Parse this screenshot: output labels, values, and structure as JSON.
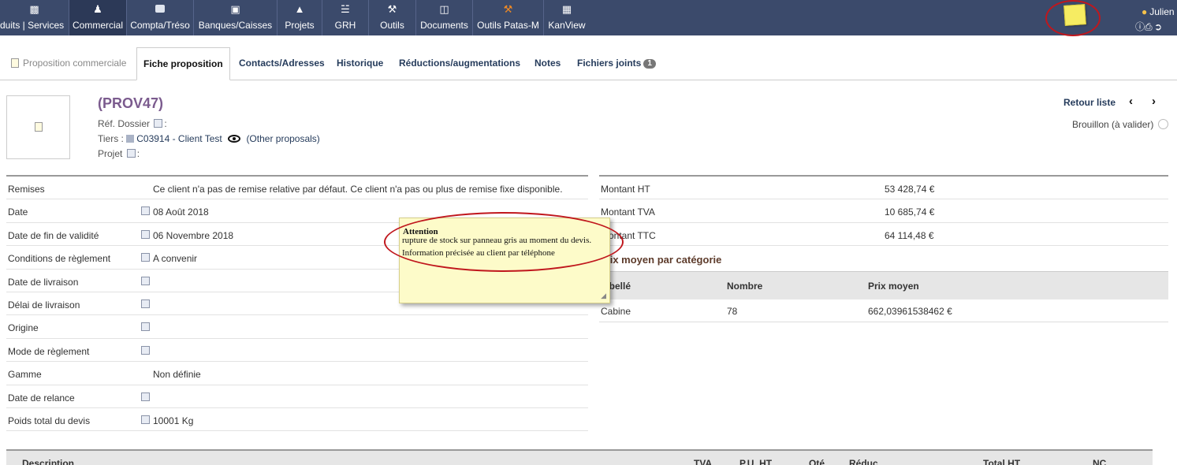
{
  "topmenu": {
    "items": [
      {
        "label": "duits | Services",
        "icon": "products-icon"
      },
      {
        "label": "Commercial",
        "icon": "commercial-icon"
      },
      {
        "label": "Compta/Tréso",
        "icon": "accounting-icon"
      },
      {
        "label": "Banques/Caisses",
        "icon": "bank-icon"
      },
      {
        "label": "Projets",
        "icon": "project-icon"
      },
      {
        "label": "GRH",
        "icon": "hr-icon"
      },
      {
        "label": "Outils",
        "icon": "tools-icon"
      },
      {
        "label": "Documents",
        "icon": "documents-icon"
      },
      {
        "label": "Outils Patas-M",
        "icon": "hammer-icon"
      },
      {
        "label": "KanView",
        "icon": "kanban-icon"
      }
    ],
    "active": "Commercial",
    "user": "Julien",
    "colors": {
      "bar": "#3b4a6b",
      "active": "#2c3957",
      "note": "#f6ec62",
      "highlight": "#c0171d"
    }
  },
  "tabs": [
    {
      "label": "Proposition commerciale"
    },
    {
      "label": "Fiche proposition"
    },
    {
      "label": "Contacts/Adresses"
    },
    {
      "label": "Historique"
    },
    {
      "label": "Réductions/augmentations"
    },
    {
      "label": "Notes"
    },
    {
      "label": "Fichiers joints",
      "badge": "1"
    }
  ],
  "header": {
    "ref": "(PROV47)",
    "ref_dossier_label": "Réf. Dossier",
    "tiers_label": "Tiers :",
    "tiers_value": "C03914 - Client Test",
    "other_proposals": "(Other proposals)",
    "projet_label": "Projet",
    "colon": ":",
    "back_list": "Retour liste",
    "prev": "‹",
    "next": "›",
    "status": "Brouillon (à valider)"
  },
  "fields": [
    {
      "label": "Remises",
      "value": "Ce client n'a pas de remise relative par défaut. Ce client n'a pas ou plus de remise fixe disponible.",
      "editable": false
    },
    {
      "label": "Date",
      "value": "08 Août 2018",
      "editable": true
    },
    {
      "label": "Date de fin de validité",
      "value": "06 Novembre 2018",
      "editable": true
    },
    {
      "label": "Conditions de règlement",
      "value": "A convenir",
      "editable": true
    },
    {
      "label": "Date de livraison",
      "value": "",
      "editable": true
    },
    {
      "label": "Délai de livraison",
      "value": "",
      "editable": true
    },
    {
      "label": "Origine",
      "value": "",
      "editable": true
    },
    {
      "label": "Mode de règlement",
      "value": "",
      "editable": true
    },
    {
      "label": "Gamme",
      "value": "Non définie",
      "editable": false
    },
    {
      "label": "Date de relance",
      "value": "",
      "editable": true
    },
    {
      "label": "Poids total du devis",
      "value": "10001 Kg",
      "editable": true
    }
  ],
  "amounts": [
    {
      "label": "Montant HT",
      "value": "53 428,74 €"
    },
    {
      "label": "Montant TVA",
      "value": "10 685,74 €"
    },
    {
      "label": "Montant TTC",
      "value": "64 114,48 €"
    }
  ],
  "avg_price": {
    "title": "Prix moyen par catégorie",
    "headers": [
      "Libellé",
      "Nombre",
      "Prix moyen"
    ],
    "rows": [
      [
        "Cabine",
        "78",
        "662,03961538462 €"
      ]
    ]
  },
  "note_popup": {
    "title": "Attention",
    "line1": "rupture de stock sur panneau gris au moment du devis.",
    "line2": "Information précisée au client par téléphone"
  },
  "lines_header": [
    "Description",
    "TVA",
    "P.U. HT",
    "Qté",
    "Réduc.",
    "Total HT",
    "NC"
  ]
}
